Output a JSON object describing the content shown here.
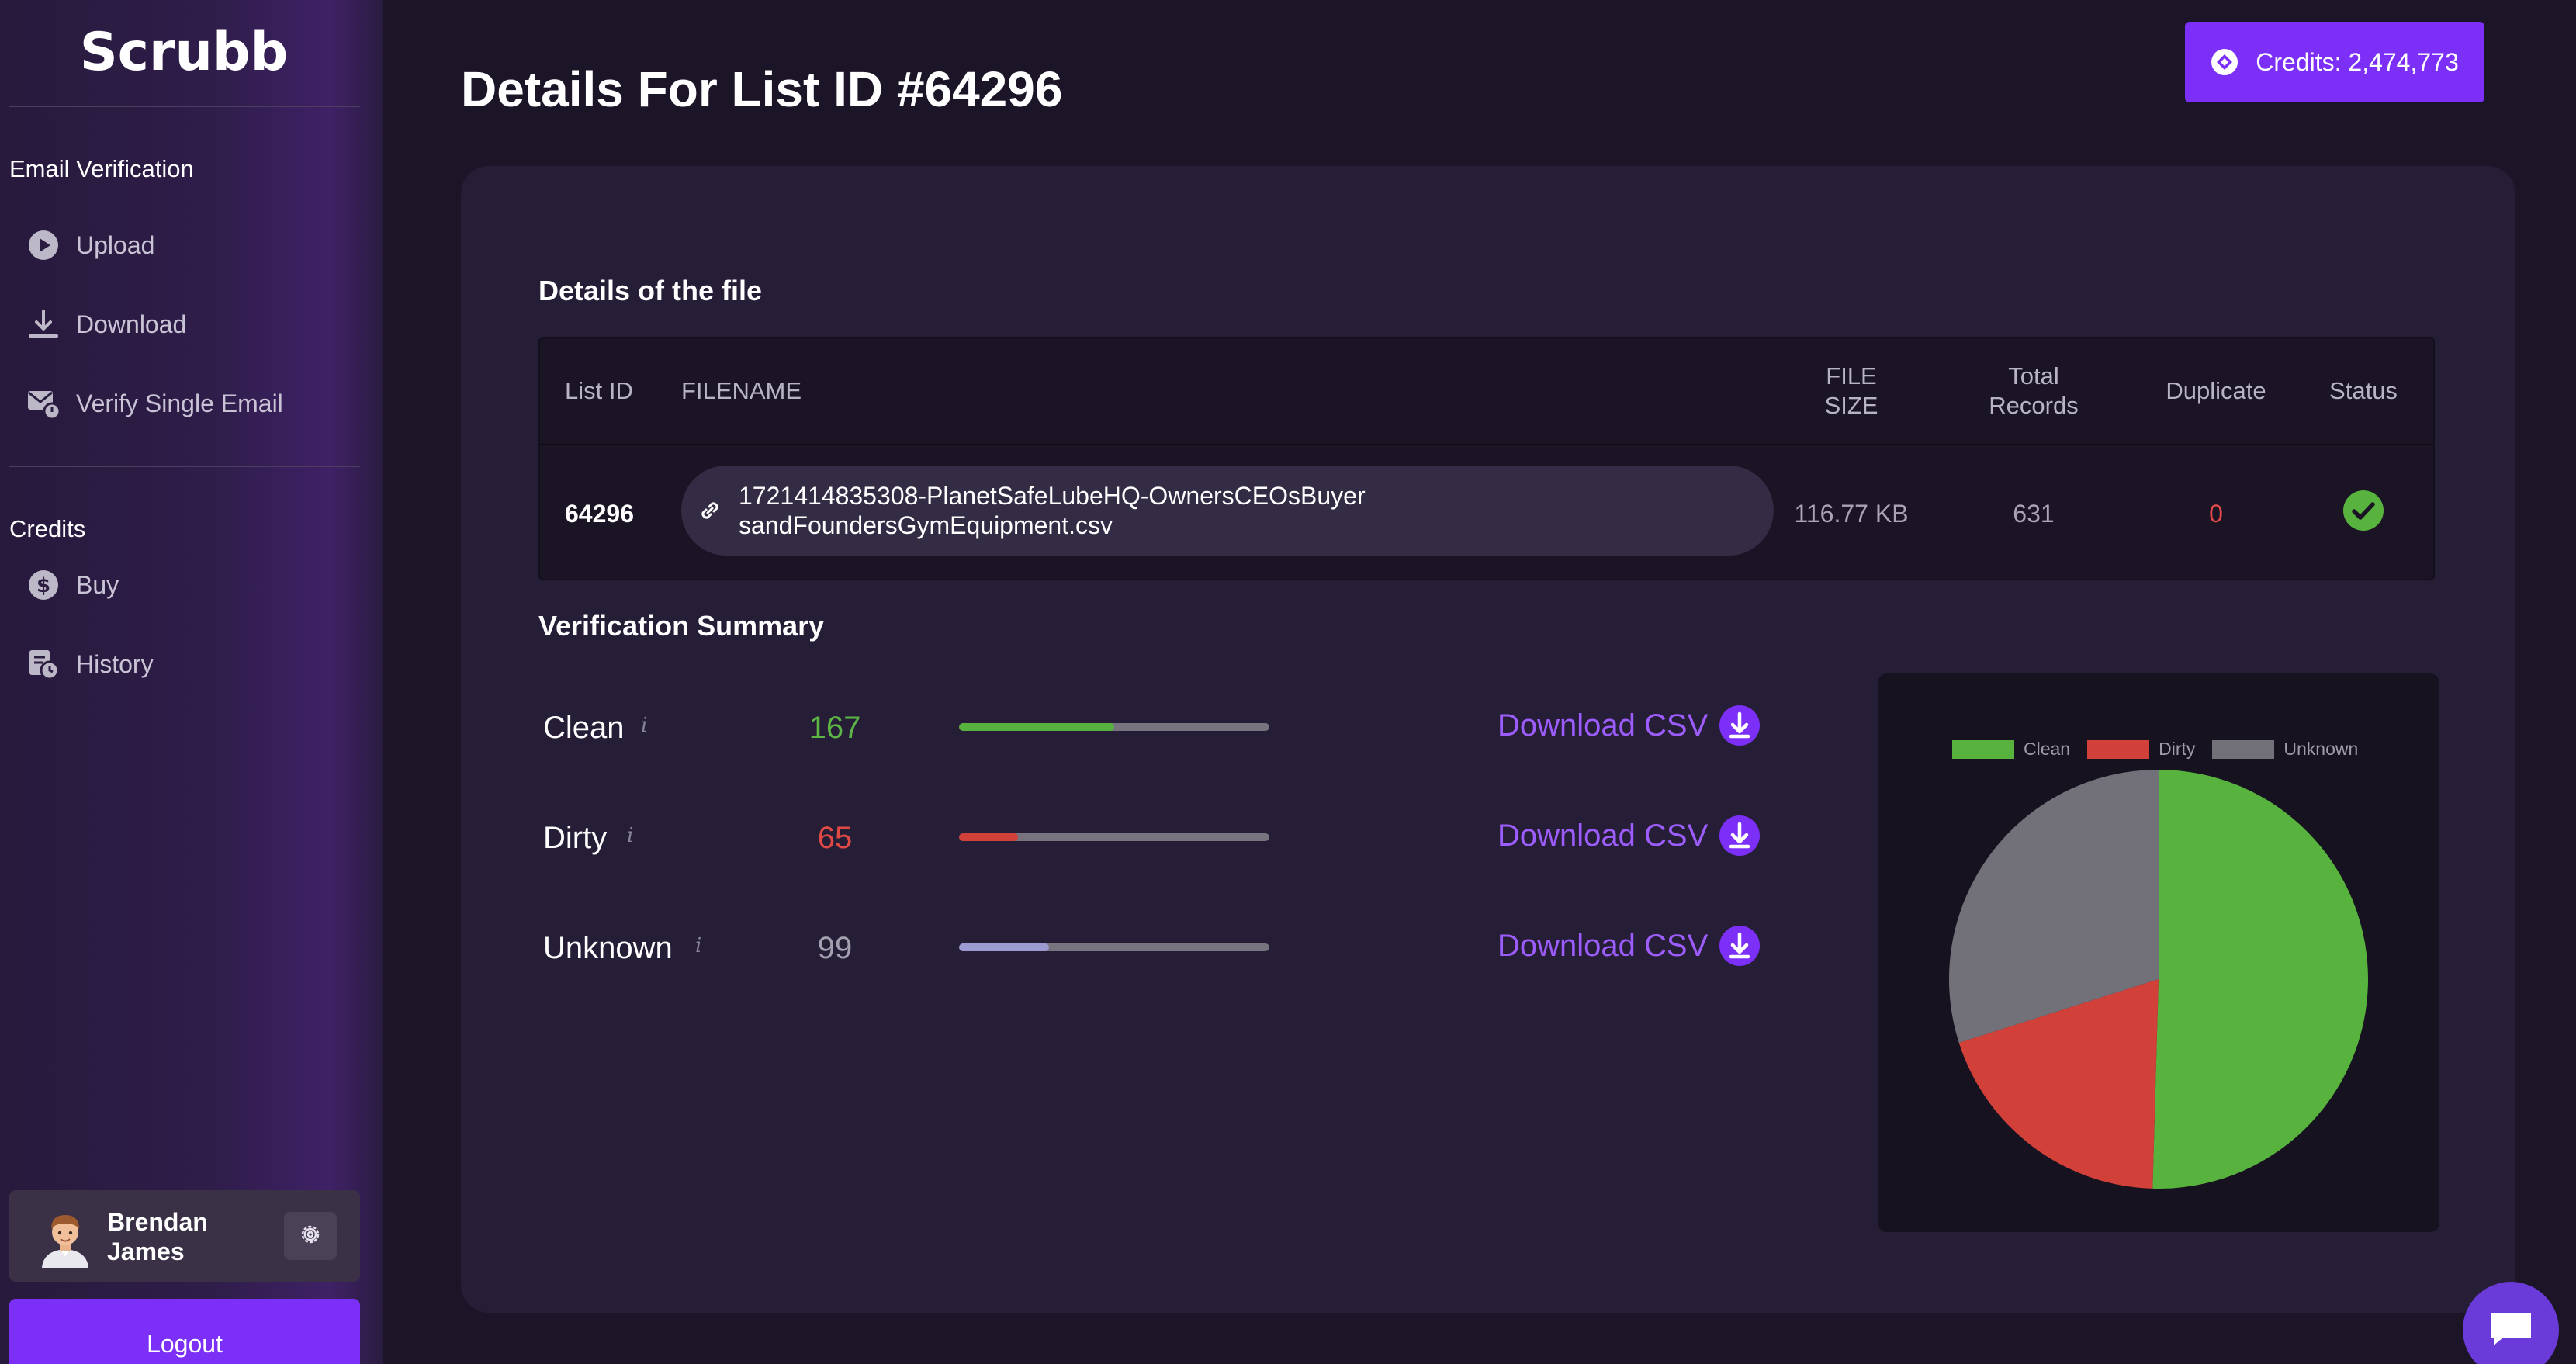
{
  "brand": "Scrubb",
  "sidebar": {
    "email_section": "Email Verification",
    "email_items": [
      {
        "label": "Upload",
        "icon": "play-circle-icon"
      },
      {
        "label": "Download",
        "icon": "download-icon"
      },
      {
        "label": "Verify Single Email",
        "icon": "mail-verify-icon"
      }
    ],
    "credits_section": "Credits",
    "credit_items": [
      {
        "label": "Buy",
        "icon": "dollar-circle-icon"
      },
      {
        "label": "History",
        "icon": "history-icon"
      }
    ],
    "profile_name": "Brendan James",
    "logout_label": "Logout"
  },
  "header": {
    "title": "Details For List ID #64296",
    "credits_label": "Credits: 2,474,773"
  },
  "file_details": {
    "heading": "Details of the file",
    "columns": {
      "list_id": "List ID",
      "filename": "FILENAME",
      "file_size": "FILE SIZE",
      "total_records": "Total Records",
      "duplicate": "Duplicate",
      "status": "Status"
    },
    "row": {
      "list_id": "64296",
      "filename": "1721414835308-PlanetSafeLubeHQ-OwnersCEOsBuyersandFoundersGymEquipment.csv",
      "file_size": "116.77 KB",
      "total_records": "631",
      "duplicate": "0",
      "status": "complete"
    }
  },
  "summary": {
    "heading": "Verification Summary",
    "info_glyph": "i",
    "download_label": "Download CSV",
    "rows": [
      {
        "label": "Clean",
        "count": "167",
        "color": "#57b33e",
        "fraction": 0.5
      },
      {
        "label": "Dirty",
        "count": "65",
        "color": "#d2403a",
        "fraction": 0.19
      },
      {
        "label": "Unknown",
        "count": "99",
        "color": "#9b9bd2",
        "fraction": 0.29
      }
    ]
  },
  "chart_data": {
    "type": "pie",
    "categories": [
      "Clean",
      "Dirty",
      "Unknown"
    ],
    "values": [
      167,
      65,
      99
    ],
    "colors": [
      "#57b33e",
      "#d2403a",
      "#727179"
    ],
    "legend": "top"
  },
  "colors": {
    "accent": "#7b2ff7",
    "link": "#9c5dfc",
    "success": "#57b33e",
    "danger": "#d2403a"
  }
}
